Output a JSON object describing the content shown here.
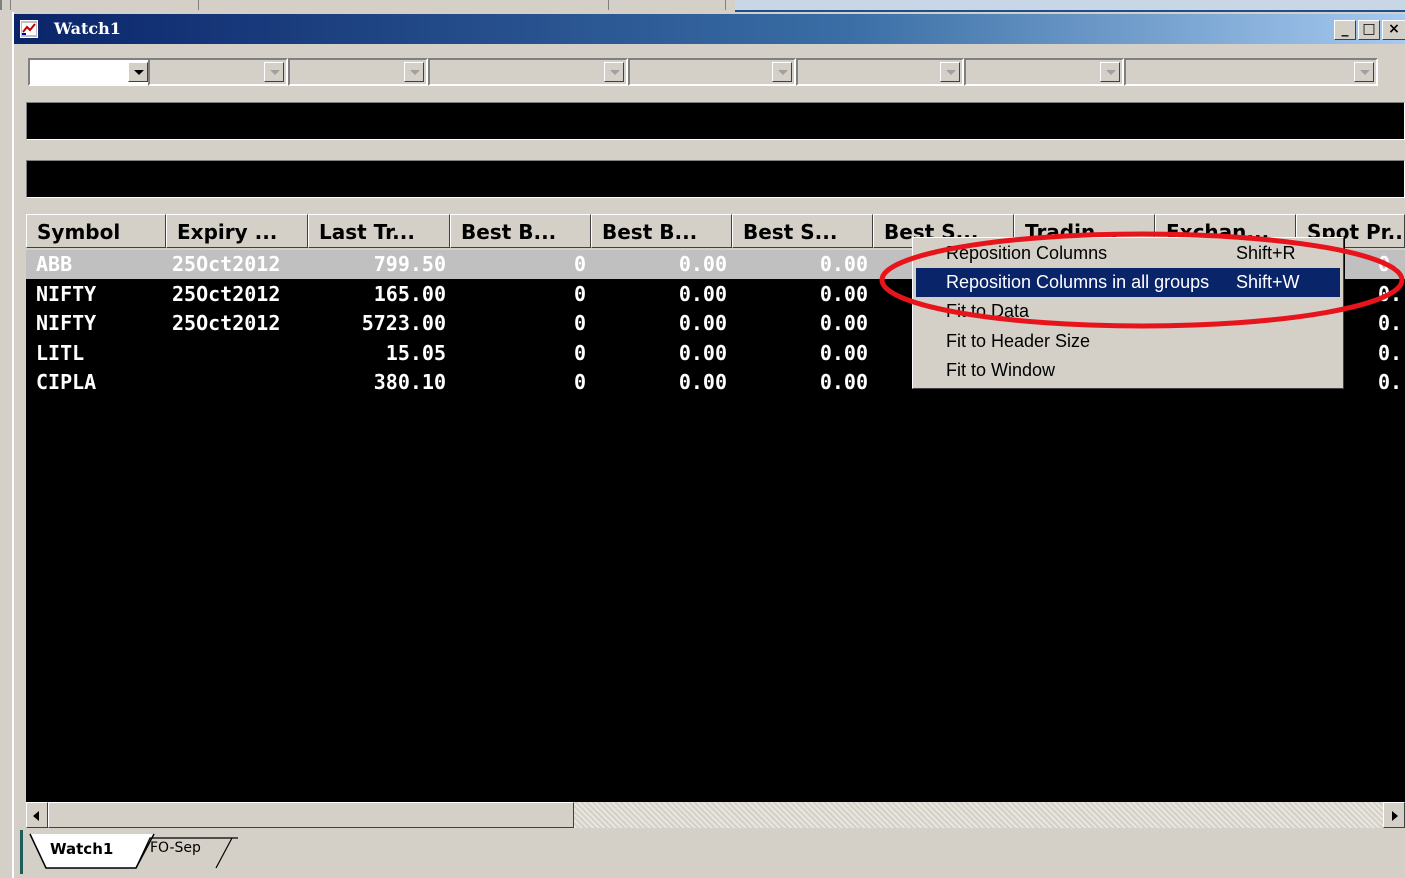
{
  "window": {
    "title": "Watch1"
  },
  "columns": [
    "Symbol",
    "Expiry ...",
    "Last Tr...",
    "Best B...",
    "Best B...",
    "Best S...",
    "Best S...",
    "Tradin...",
    "Exchan...",
    "Spot Pr..."
  ],
  "rows": [
    {
      "symbol": "ABB",
      "expiry": "25Oct2012",
      "last": "799.50",
      "bb1": "0",
      "bb2": "0.00",
      "bs1": "0.00",
      "spot": "0."
    },
    {
      "symbol": "NIFTY",
      "expiry": "25Oct2012",
      "last": "165.00",
      "bb1": "0",
      "bb2": "0.00",
      "bs1": "0.00",
      "spot": "0."
    },
    {
      "symbol": "NIFTY",
      "expiry": "25Oct2012",
      "last": "5723.00",
      "bb1": "0",
      "bb2": "0.00",
      "bs1": "0.00",
      "spot": "0."
    },
    {
      "symbol": "LITL",
      "expiry": "",
      "last": "15.05",
      "bb1": "0",
      "bb2": "0.00",
      "bs1": "0.00",
      "spot": "0."
    },
    {
      "symbol": "CIPLA",
      "expiry": "",
      "last": "380.10",
      "bb1": "0",
      "bb2": "0.00",
      "bs1": "0.00",
      "spot": "0."
    }
  ],
  "context_menu": [
    {
      "label": "Reposition Columns",
      "shortcut": "Shift+R"
    },
    {
      "label": "Reposition Columns in all groups",
      "shortcut": "Shift+W"
    },
    {
      "label": "Fit to Data",
      "shortcut": ""
    },
    {
      "label": "Fit to Header Size",
      "shortcut": ""
    },
    {
      "label": "Fit to Window",
      "shortcut": ""
    }
  ],
  "tabs": [
    "Watch1",
    "FO-Sep"
  ],
  "colors": {
    "title_bar": "#0a246a",
    "menu_highlight": "#0a246a",
    "annotation_circle": "#e8141c",
    "grid_bg": "#000000"
  },
  "icons": {
    "app": "watch-window-icon",
    "minimize": "minimize-icon",
    "maximize": "maximize-icon",
    "close": "close-icon"
  }
}
